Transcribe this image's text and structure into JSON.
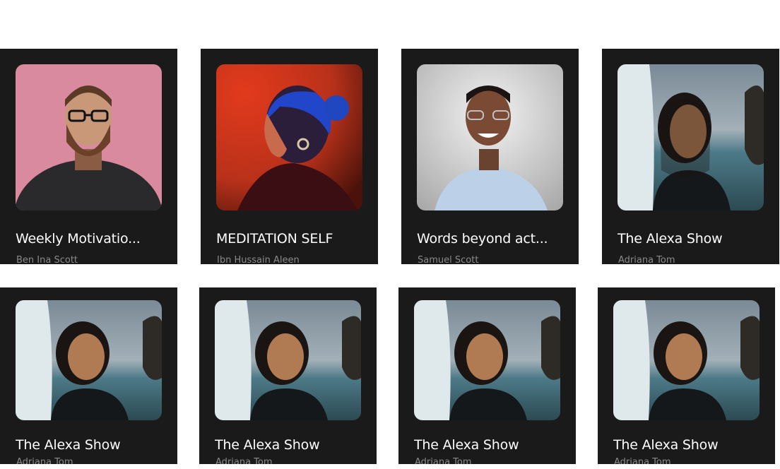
{
  "cards": [
    {
      "title": "Weekly Motivatio...",
      "author": "Ben Ina Scott",
      "image": "bearded-man-portrait"
    },
    {
      "title": "MEDITATION SELF",
      "author": "Ibn Hussain Aleen",
      "image": "woman-profile-neon"
    },
    {
      "title": "Words beyond act...",
      "author": "Samuel Scott",
      "image": "smiling-man-glasses"
    },
    {
      "title": "The Alexa Show",
      "author": "Adriana Tom",
      "image": "woman-surfboard-beach"
    },
    {
      "title": "The Alexa Show",
      "author": "Adriana Tom",
      "image": "woman-surfboard-beach"
    },
    {
      "title": "The Alexa Show",
      "author": "Adriana Tom",
      "image": "woman-surfboard-beach"
    },
    {
      "title": "The Alexa Show",
      "author": "Adriana Tom",
      "image": "woman-surfboard-beach"
    },
    {
      "title": "The Alexa Show",
      "author": "Adriana Tom",
      "image": "woman-surfboard-beach"
    }
  ],
  "colors": {
    "card_bg": "#1a1a1a",
    "title": "#ffffff",
    "author": "#8a8a8a"
  }
}
